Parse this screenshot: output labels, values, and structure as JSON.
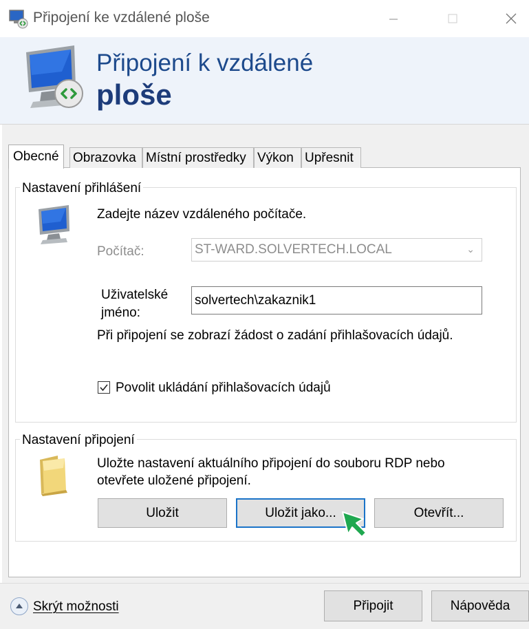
{
  "window": {
    "title": "Připojení ke vzdálené ploše",
    "minimize_icon": "minimize-icon",
    "maximize_icon": "maximize-icon",
    "close_icon": "close-icon"
  },
  "banner": {
    "title_line1": "Připojení k vzdálené",
    "title_line2": "ploše"
  },
  "tabs": [
    {
      "label": "Obecné",
      "active": true
    },
    {
      "label": "Obrazovka"
    },
    {
      "label": "Místní prostředky"
    },
    {
      "label": "Výkon"
    },
    {
      "label": "Upřesnit"
    }
  ],
  "login_settings": {
    "group_label": "Nastavení přihlášení",
    "instruction": "Zadejte název vzdáleného počítače.",
    "computer_label": "Počítač:",
    "computer_value": "ST-WARD.SOLVERTECH.LOCAL",
    "username_label_line1": "Uživatelské",
    "username_label_line2": "jméno:",
    "username_value": "solvertech\\zakaznik1",
    "prompt_text": "Při připojení se zobrazí žádost o zadání přihlašovacích údajů.",
    "save_credentials_label": "Povolit ukládání přihlašovacích údajů",
    "save_credentials_checked": true
  },
  "connection_settings": {
    "group_label": "Nastavení připojení",
    "description_line1": "Uložte nastavení aktuálního připojení do souboru RDP nebo",
    "description_line2": "otevřete uložené připojení.",
    "save_button": "Uložit",
    "save_as_button": "Uložit jako...",
    "open_button": "Otevřít..."
  },
  "bottom": {
    "hide_options_label": "Skrýt možnosti",
    "connect_button": "Připojit",
    "help_button": "Nápověda"
  },
  "colors": {
    "banner_title": "#1d4a8c",
    "banner_bg": "#eef3fa",
    "focus_border": "#1a73c8",
    "cursor": "#1fa850"
  }
}
